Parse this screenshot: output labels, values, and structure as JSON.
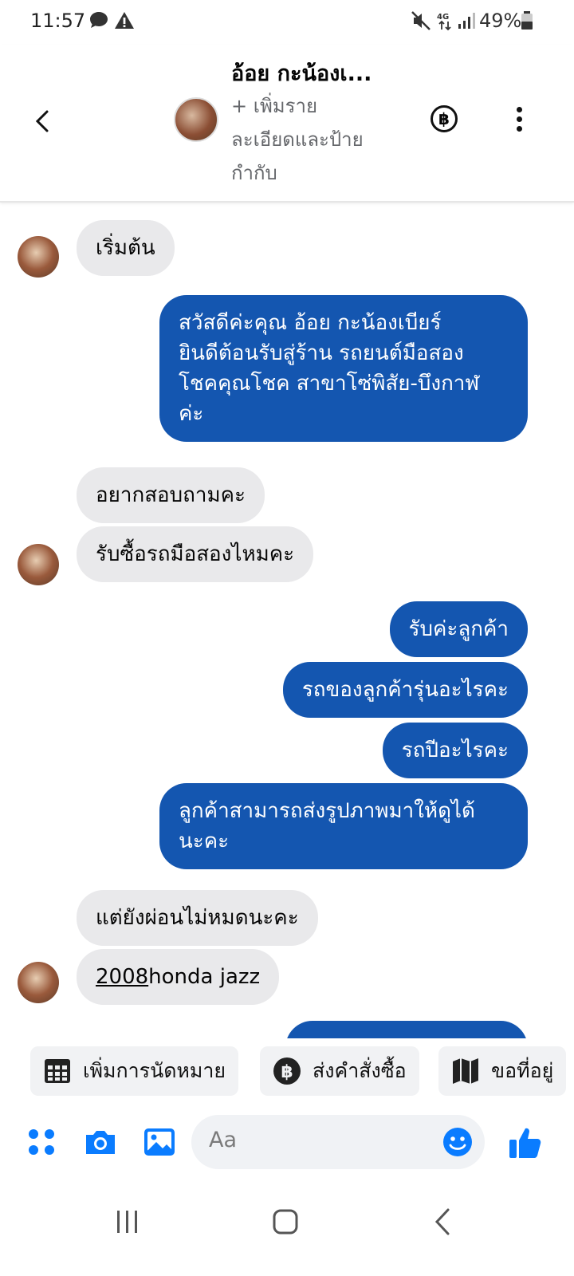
{
  "status_bar": {
    "time": "11:57",
    "battery": "49%"
  },
  "header": {
    "contact_name": "อ้อย กะน้องเ...",
    "add_details": "+ เพิ่มราย\nละเอียดและป้าย\nกำกับ",
    "baht_symbol": "฿"
  },
  "messages": [
    {
      "side": "in",
      "text": "เริ่มต้น"
    },
    {
      "side": "out",
      "text": "สวัสดีค่ะคุณ อ้อย กะน้องเบียร์\nยินดีต้อนรับสู่ร้าน รถยนต์มือสอง\nโชคคุณโชค สาขาโซ่พิสัย-บึงกาฬ\nค่ะ"
    },
    {
      "side": "in",
      "text": "อยากสอบถามคะ"
    },
    {
      "side": "in",
      "text": "รับซื้อรถมือสองไหมคะ"
    },
    {
      "side": "out",
      "text": "รับค่ะลูกค้า"
    },
    {
      "side": "out",
      "text": "รถของลูกค้ารุ่นอะไรคะ"
    },
    {
      "side": "out",
      "text": "รถปีอะไรคะ"
    },
    {
      "side": "out",
      "text": "ลูกค้าสามารถส่งรูปภาพมาให้ดูได้\nนะคะ"
    },
    {
      "side": "in",
      "text": "แต่ยังผ่อนไม่หมดนะคะ"
    },
    {
      "side": "in",
      "year": "2008",
      "text": "honda jazz"
    }
  ],
  "quick_actions": [
    {
      "label": "เพิ่มการนัดหมาย",
      "icon": "calendar-icon"
    },
    {
      "label": "ส่งคำสั่งซื้อ",
      "icon": "baht-icon"
    },
    {
      "label": "ขอที่อยู่",
      "icon": "map-icon"
    }
  ],
  "composer": {
    "placeholder": "Aa"
  },
  "colors": {
    "outgoing_bubble": "#1456b0",
    "incoming_bubble": "#e9e9eb",
    "accent": "#0a7cff"
  }
}
